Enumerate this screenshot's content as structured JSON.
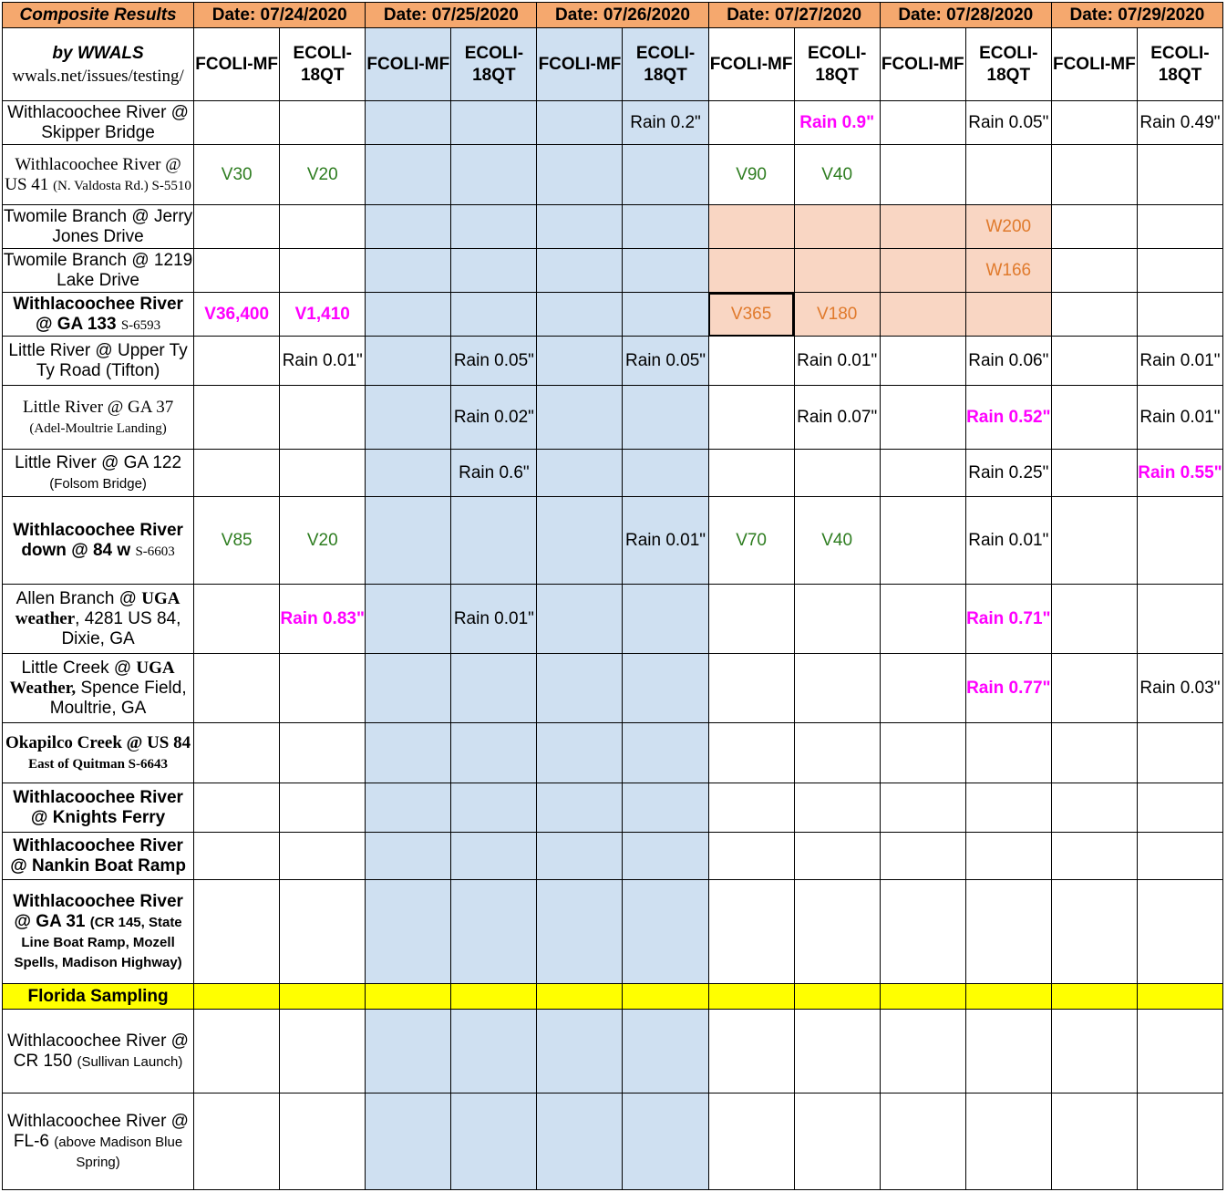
{
  "header": {
    "corner": "Composite Results",
    "by": "by WWALS",
    "link": "wwals.net/issues/testing/",
    "dates": [
      "Date:  07/24/2020",
      "Date:  07/25/2020",
      "Date:  07/26/2020",
      "Date:  07/27/2020",
      "Date:  07/28/2020",
      "Date:  07/29/2020"
    ],
    "col_a": "FCOLI-MF",
    "col_b": "ECOLI-18QT"
  },
  "rows": {
    "r1": {
      "name": "Withlacoochee River @ Skipper Bridge",
      "d3b": "Rain 0.2\"",
      "d4b": "Rain 0.9\"",
      "d5b": "Rain 0.05\"",
      "d6b": "Rain 0.49\""
    },
    "r2": {
      "name_a": "Withlacoochee River @ US 41",
      "name_b": "(N. Valdosta Rd.) S-5510",
      "d1a": "V30",
      "d1b": "V20",
      "d4a": "V90",
      "d4b": "V40"
    },
    "r3": {
      "name": "Twomile Branch @ Jerry Jones Drive",
      "d5b": "W200"
    },
    "r4": {
      "name": "Twomile Branch @ 1219 Lake Drive",
      "d5b": "W166"
    },
    "r5": {
      "name_a": "Withlacoochee River @ GA 133",
      "name_b": "S-6593",
      "d1a": "V36,400",
      "d1b": "V1,410",
      "d4a": "V365",
      "d4b": "V180"
    },
    "r6": {
      "name": "Little River @ Upper Ty Ty Road (Tifton)",
      "d1b": "Rain 0.01\"",
      "d2b": "Rain 0.05\"",
      "d3b": "Rain 0.05\"",
      "d4b": "Rain 0.01\"",
      "d5b": "Rain 0.06\"",
      "d6b": "Rain 0.01\""
    },
    "r7": {
      "name_a": "Little River @ GA 37",
      "name_b": "(Adel-Moultrie Landing)",
      "d2b": "Rain 0.02\"",
      "d4b": "Rain 0.07\"",
      "d5b": "Rain 0.52\"",
      "d6b": "Rain 0.01\""
    },
    "r8": {
      "name_a": "Little River @ GA 122",
      "name_b": "(Folsom Bridge)",
      "d2b": "Rain 0.6\"",
      "d5b": "Rain 0.25\"",
      "d6b": "Rain 0.55\""
    },
    "r9": {
      "name_a": "Withlacoochee River down @ 84 w",
      "name_b": "S-6603",
      "d1a": "V85",
      "d1b": "V20",
      "d3b": "Rain 0.01\"",
      "d4a": "V70",
      "d4b": "V40",
      "d5b": "Rain 0.01\""
    },
    "r10": {
      "name_a": "Allen  Branch @",
      "name_b": "UGA weather",
      "name_c": ", 4281 US 84, Dixie, GA",
      "d1b": "Rain 0.83\"",
      "d2b": "Rain 0.01\"",
      "d5b": "Rain 0.71\""
    },
    "r11": {
      "name_a": "Little Creek @",
      "name_b": "UGA Weather,",
      "name_c": "Spence Field, Moultrie, GA",
      "d5b": "Rain 0.77\"",
      "d6b": "Rain 0.03\""
    },
    "r12": {
      "name_a": "Okapilco Creek @ US 84",
      "name_b": "East of Quitman S-6643"
    },
    "r13": {
      "name": "Withlacoochee River @ Knights Ferry"
    },
    "r14": {
      "name": "Withlacoochee River @ Nankin Boat Ramp"
    },
    "r15": {
      "name_a": "Withlacoochee River @ GA 31",
      "name_b": "(CR 145, State Line Boat Ramp, Mozell Spells, Madison Highway)"
    },
    "fl": {
      "label": "Florida Sampling"
    },
    "r16": {
      "name_a": "Withlacoochee River @ CR 150",
      "name_b": "(Sullivan Launch)"
    },
    "r17": {
      "name_a": "Withlacoochee River @ FL-6",
      "name_b": "(above Madison Blue Spring)"
    }
  },
  "colors": {
    "header_orange": "#f5a86e",
    "blue_band": "#cfe0f1",
    "peach_highlight": "#f9d6c3",
    "yellow_band": "#ffff00",
    "magenta": "#ff00ff",
    "green": "#2e7d20",
    "orange_text": "#e07a2c"
  }
}
